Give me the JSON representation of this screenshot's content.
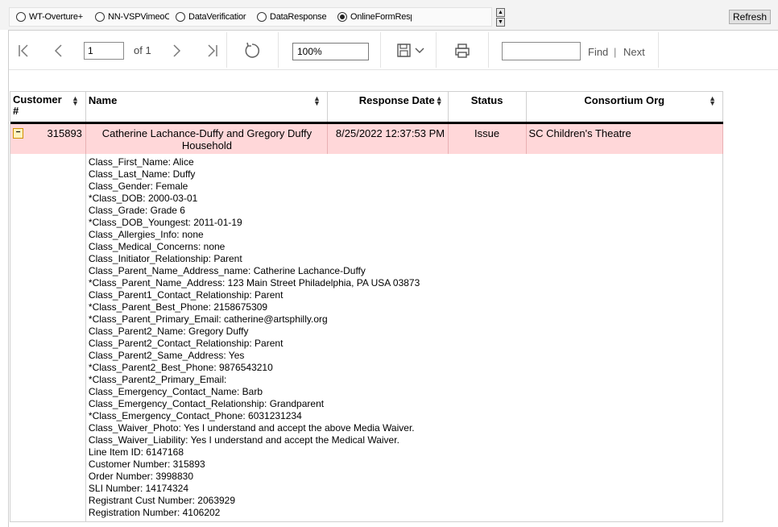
{
  "report_selector": {
    "options": [
      {
        "label": "WT-Overture+",
        "selected": false
      },
      {
        "label": "NN-VSPVimeoO",
        "selected": false
      },
      {
        "label": "DataVerificatior",
        "selected": false
      },
      {
        "label": "DataResponse",
        "selected": false
      },
      {
        "label": "OnlineFormResp",
        "selected": true
      }
    ]
  },
  "refresh_label": "Refresh",
  "toolbar": {
    "page_current": "1",
    "page_of": "of 1",
    "zoom": "100%",
    "find_label": "Find",
    "separator": "|",
    "next_label": "Next"
  },
  "table": {
    "headers": {
      "customer": "Customer #",
      "name": "Name",
      "response_date": "Response Date",
      "status": "Status",
      "consortium": "Consortium Org"
    },
    "row": {
      "expander": "−",
      "customer_number": "315893",
      "name": "Catherine Lachance-Duffy and Gregory Duffy Household",
      "response_date": "8/25/2022 12:37:53 PM",
      "status": "Issue",
      "consortium": "SC Children's Theatre",
      "highlight_color": "#ffd7d9"
    },
    "details": [
      "Class_First_Name: Alice",
      "Class_Last_Name: Duffy",
      "Class_Gender: Female",
      "*Class_DOB: 2000-03-01",
      "Class_Grade: Grade 6",
      "*Class_DOB_Youngest: 2011-01-19",
      "Class_Allergies_Info: none",
      "Class_Medical_Concerns: none",
      "Class_Initiator_Relationship: Parent",
      "Class_Parent_Name_Address_name: Catherine Lachance-Duffy",
      "*Class_Parent_Name_Address: 123 Main Street  Philadelphia, PA USA 03873",
      "Class_Parent1_Contact_Relationship: Parent",
      "*Class_Parent_Best_Phone: 2158675309",
      "*Class_Parent_Primary_Email: catherine@artsphilly.org",
      "Class_Parent2_Name: Gregory Duffy",
      "Class_Parent2_Contact_Relationship: Parent",
      "Class_Parent2_Same_Address: Yes",
      "*Class_Parent2_Best_Phone: 9876543210",
      "*Class_Parent2_Primary_Email:",
      "Class_Emergency_Contact_Name: Barb",
      "Class_Emergency_Contact_Relationship: Grandparent",
      "*Class_Emergency_Contact_Phone: 6031231234",
      "Class_Waiver_Photo: Yes I understand and accept the above Media Waiver.",
      "Class_Waiver_Liability: Yes I understand and accept the Medical Waiver.",
      "Line Item ID: 6147168",
      "Customer Number: 315893",
      "Order Number: 3998830",
      "SLI Number: 14174324",
      "Registrant Cust Number: 2063929",
      "Registration Number: 4106202"
    ]
  }
}
